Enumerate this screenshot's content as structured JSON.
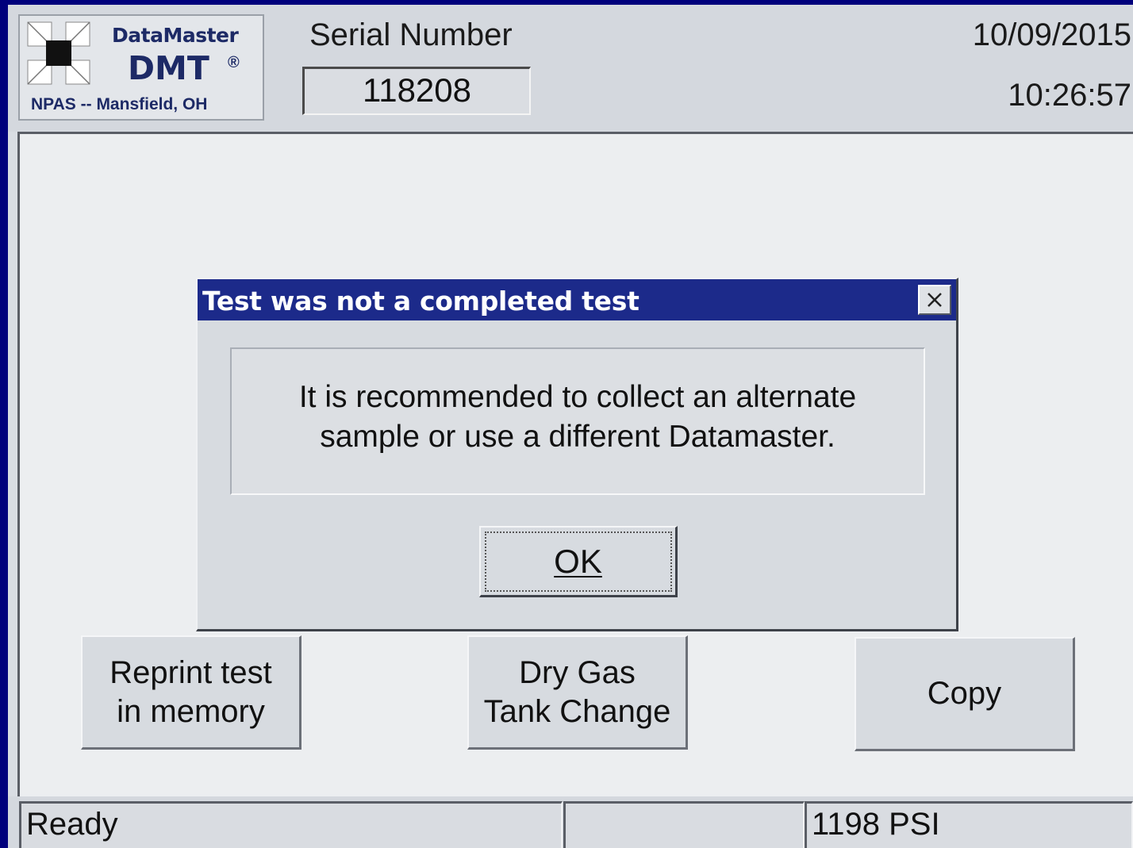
{
  "header": {
    "brand_name": "DataMaster",
    "brand_model": "DMT",
    "registered_mark": "®",
    "brand_location": "NPAS -- Mansfield, OH",
    "serial_label": "Serial Number",
    "serial_value": "118208",
    "date": "10/09/2015",
    "time": "10:26:57"
  },
  "buttons": {
    "reprint_line1": "Reprint test",
    "reprint_line2": "in memory",
    "drygas_line1": "Dry Gas",
    "drygas_line2": "Tank Change",
    "copy": "Copy"
  },
  "dialog": {
    "title": "Test was not a completed test",
    "close_label": "×",
    "message_line1": "It is recommended to collect an alternate",
    "message_line2": "sample or use a different Datamaster.",
    "ok_label": "OK"
  },
  "statusbar": {
    "status": "Ready",
    "middle": "",
    "pressure": "1198 PSI"
  },
  "colors": {
    "frame": "#00007c",
    "titlebar": "#1c2a8a",
    "brand": "#1d2a66",
    "panel": "#d7dbe0"
  },
  "icons": {
    "logo": "datamaster-logo-icon",
    "close": "close-icon"
  }
}
